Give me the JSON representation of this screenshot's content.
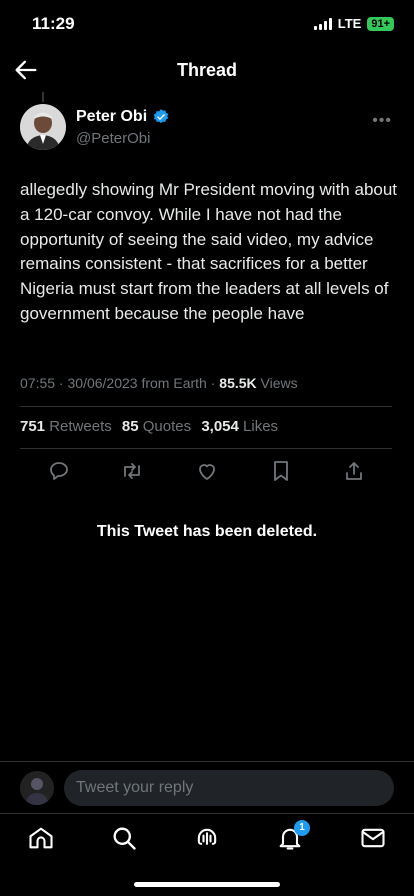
{
  "status": {
    "time": "11:29",
    "network": "LTE",
    "battery": "91+"
  },
  "header": {
    "title": "Thread"
  },
  "tweet": {
    "author_name": "Peter Obi",
    "author_handle": "@PeterObi",
    "text": "allegedly showing Mr President moving with about a 120-car convoy. While I have not had the opportunity of seeing the said video, my advice remains consistent - that sacrifices for a better Nigeria must start from the leaders at all levels of government because the people have",
    "time": "07:55",
    "date": "30/06/2023",
    "source": "from Earth",
    "views_count": "85.5K",
    "views_label": "Views",
    "retweets_count": "751",
    "retweets_label": "Retweets",
    "quotes_count": "85",
    "quotes_label": "Quotes",
    "likes_count": "3,054",
    "likes_label": "Likes"
  },
  "deleted_notice": "This Tweet has been deleted.",
  "reply": {
    "placeholder": "Tweet your reply"
  },
  "tabbar": {
    "notifications_badge": "1"
  },
  "colors": {
    "accent": "#1d9bf0",
    "background": "#000000",
    "muted": "#71767b",
    "divider": "#2f3336"
  }
}
